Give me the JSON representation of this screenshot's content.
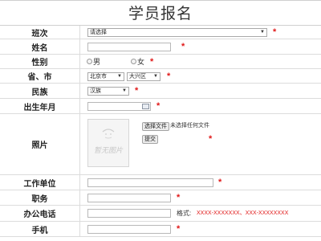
{
  "title": "学员报名",
  "required_mark": "*",
  "labels": {
    "class": "班次",
    "name": "姓名",
    "gender": "性别",
    "province_city": "省、市",
    "ethnicity": "民族",
    "birth": "出生年月",
    "photo": "照片",
    "employer": "工作单位",
    "position": "职务",
    "office_phone": "办公电话",
    "mobile": "手机"
  },
  "class_select": {
    "value": "请选择"
  },
  "gender": {
    "male": "男",
    "female": "女"
  },
  "province_select": {
    "value": "北京市"
  },
  "city_select": {
    "value": "大兴区"
  },
  "ethnicity_select": {
    "value": "汉族"
  },
  "photo": {
    "placeholder_text": "暂无图片",
    "choose_file_button": "选择文件",
    "no_file_text": "未选择任何文件",
    "submit_button": "提交"
  },
  "office_phone": {
    "format_label": "格式:",
    "format_example": "XXXX-XXXXXXX、XXX-XXXXXXXX"
  },
  "icons": {
    "caret": "caret-down-icon",
    "calendar": "calendar-icon",
    "placeholder_face": "photo-placeholder-icon"
  },
  "colors": {
    "required": "#e01919",
    "border": "#dcdcdc"
  }
}
